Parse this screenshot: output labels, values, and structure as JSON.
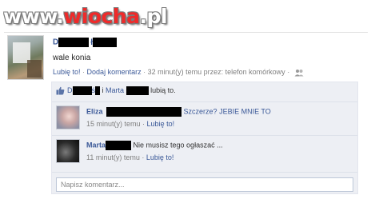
{
  "watermark": {
    "prefix": "www.",
    "accent": "wiocha",
    "suffix": ".pl"
  },
  "post": {
    "author_initial": "D",
    "author_suffix": "ł",
    "text": "wale konia",
    "actions": {
      "like": "Lubię to!",
      "comment": "Dodaj komentarz"
    },
    "meta_time": "32 minut(y) temu przez: telefon komórkowy",
    "privacy_icon": "people-icon"
  },
  "likes": {
    "name_a_initial": "D",
    "name_b_fragment": "ś",
    "connector": "i",
    "name_c": "Marta",
    "suffix": "lubią to."
  },
  "comments": [
    {
      "name": "Eliza",
      "text": "Szczerze? JEBIE MNIE TO",
      "time": "15 minut(y) temu",
      "like": "Lubię to!"
    },
    {
      "name": "Marta",
      "text": "Nie musisz tego ogłaszać ...",
      "time": "11 minut(y) temu",
      "like": "Lubię to!"
    }
  ],
  "input": {
    "placeholder": "Napisz komentarz..."
  },
  "colors": {
    "link": "#3b5998",
    "panel": "#edeff4",
    "watermark_accent": "#ef2a2a"
  }
}
